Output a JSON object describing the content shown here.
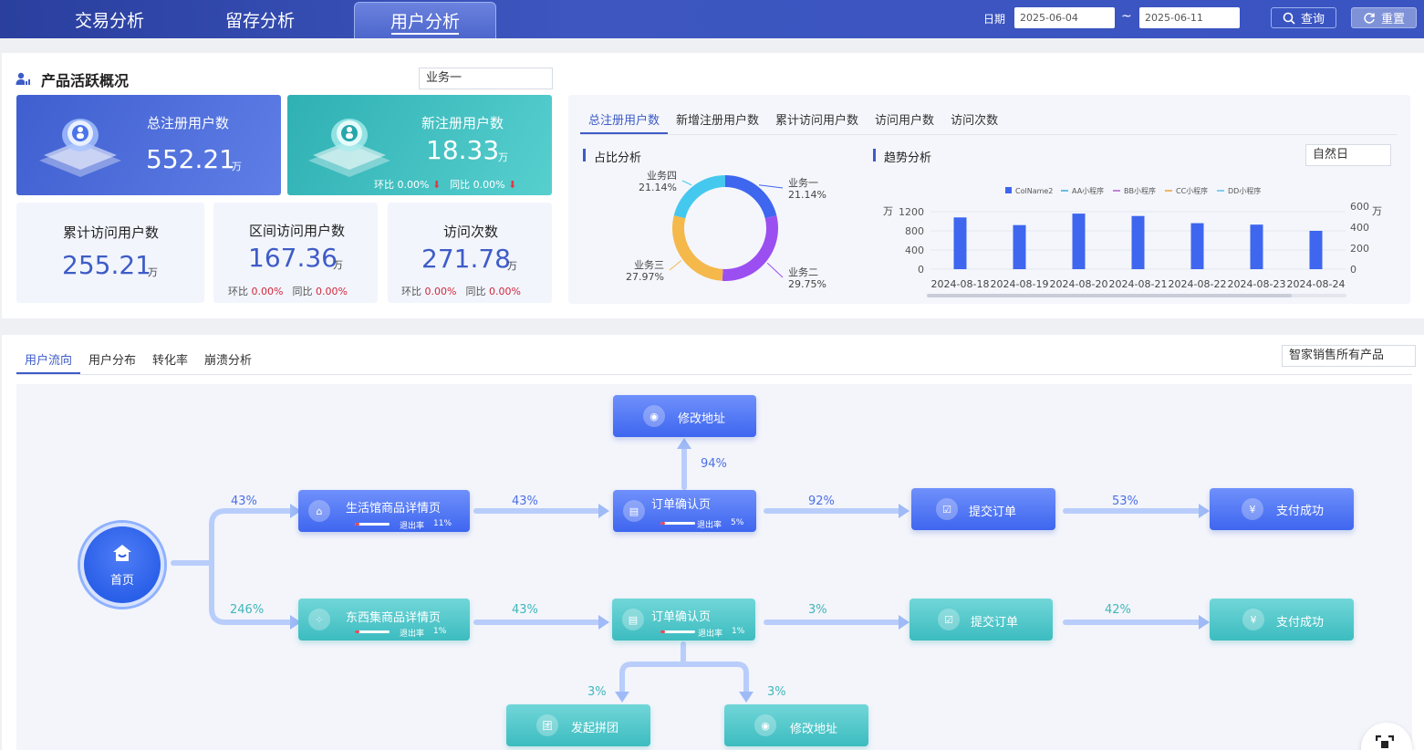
{
  "nav": {
    "tabs": [
      "交易分析",
      "留存分析",
      "用户分析"
    ],
    "active": 2
  },
  "date_filter": {
    "label": "日期",
    "start": "2025-06-04",
    "end": "2025-06-11",
    "separator": "~"
  },
  "buttons": {
    "query": "查询",
    "reset": "重置"
  },
  "overview": {
    "title": "产品活跃概况",
    "business_select": "业务一",
    "cards": {
      "total_reg": {
        "title": "总注册用户数",
        "value": "552.21",
        "unit": "万"
      },
      "new_reg": {
        "title": "新注册用户数",
        "value": "18.33",
        "unit": "万",
        "hb_label": "环比",
        "hb": "0.00%",
        "tb_label": "同比",
        "tb": "0.00%"
      },
      "cum_visit": {
        "title": "累计访问用户数",
        "value": "255.21",
        "unit": "万"
      },
      "interval_visit": {
        "title": "区间访问用户数",
        "value": "167.36",
        "unit": "万",
        "hb_label": "环比",
        "hb": "0.00%",
        "tb_label": "同比",
        "tb": "0.00%"
      },
      "visits": {
        "title": "访问次数",
        "value": "271.78",
        "unit": "万",
        "hb_label": "环比",
        "hb": "0.00%",
        "tb_label": "同比",
        "tb": "0.00%"
      }
    },
    "metric_tabs": [
      "总注册用户数",
      "新增注册用户数",
      "累计访问用户数",
      "访问用户数",
      "访问次数"
    ],
    "share_title": "占比分析",
    "trend_title": "趋势分析",
    "trend_select": "自然日"
  },
  "chart_data": [
    {
      "type": "pie",
      "title": "占比分析",
      "labels": [
        "业务一",
        "业务二",
        "业务三",
        "业务四"
      ],
      "values": [
        21.14,
        29.75,
        27.97,
        21.14
      ],
      "value_labels": [
        "21.14%",
        "29.75%",
        "27.97%",
        "21.14%"
      ],
      "colors": [
        "#3e66ef",
        "#9b4ff0",
        "#f5b84b",
        "#45c8ee"
      ]
    },
    {
      "type": "bar",
      "title": "趋势分析",
      "categories": [
        "2024-08-18",
        "2024-08-19",
        "2024-08-20",
        "2024-08-21",
        "2024-08-22",
        "2024-08-23",
        "2024-08-24"
      ],
      "series": [
        {
          "name": "ColName2",
          "values": [
            1080,
            920,
            1160,
            1110,
            960,
            930,
            800
          ]
        }
      ],
      "legend": [
        "ColName2",
        "AA小程序",
        "BB小程序",
        "CC小程序",
        "DD小程序"
      ],
      "legend_colors": [
        "#3e66ef",
        "#3fa9d8",
        "#b15ad4",
        "#f0a030",
        "#5cc0e8"
      ],
      "y_left": {
        "unit": "万",
        "ticks": [
          "0",
          "400",
          "800",
          "1200"
        ],
        "max": 1200
      },
      "y_right": {
        "unit": "万",
        "ticks": [
          "0",
          "200",
          "400",
          "600"
        ],
        "max": 600
      },
      "legend_position": "top"
    }
  ],
  "flow": {
    "tabs": [
      "用户流向",
      "用户分布",
      "转化率",
      "崩溃分析"
    ],
    "product_select": "智家销售所有产品",
    "home": "首页",
    "exit_label": "退出率",
    "nodes": {
      "life_detail": {
        "label": "生活馆商品详情页",
        "exit": "11%"
      },
      "order_top": {
        "label": "订单确认页",
        "exit": "5%"
      },
      "modify_top": {
        "label": "修改地址"
      },
      "submit_top": {
        "label": "提交订单"
      },
      "pay_top": {
        "label": "支付成功"
      },
      "east_detail": {
        "label": "东西集商品详情页",
        "exit": "1%"
      },
      "order_bottom": {
        "label": "订单确认页",
        "exit": "1%"
      },
      "submit_bottom": {
        "label": "提交订单"
      },
      "pay_bottom": {
        "label": "支付成功"
      },
      "group_buy": {
        "label": "发起拼团"
      },
      "modify_bottom": {
        "label": "修改地址"
      }
    },
    "percents": {
      "home_top": "43%",
      "home_bottom": "246%",
      "top_1": "43%",
      "top_up": "94%",
      "top_2": "92%",
      "top_3": "53%",
      "bot_1": "43%",
      "bot_2": "3%",
      "bot_3": "42%",
      "down_left": "3%",
      "down_right": "3%"
    }
  }
}
